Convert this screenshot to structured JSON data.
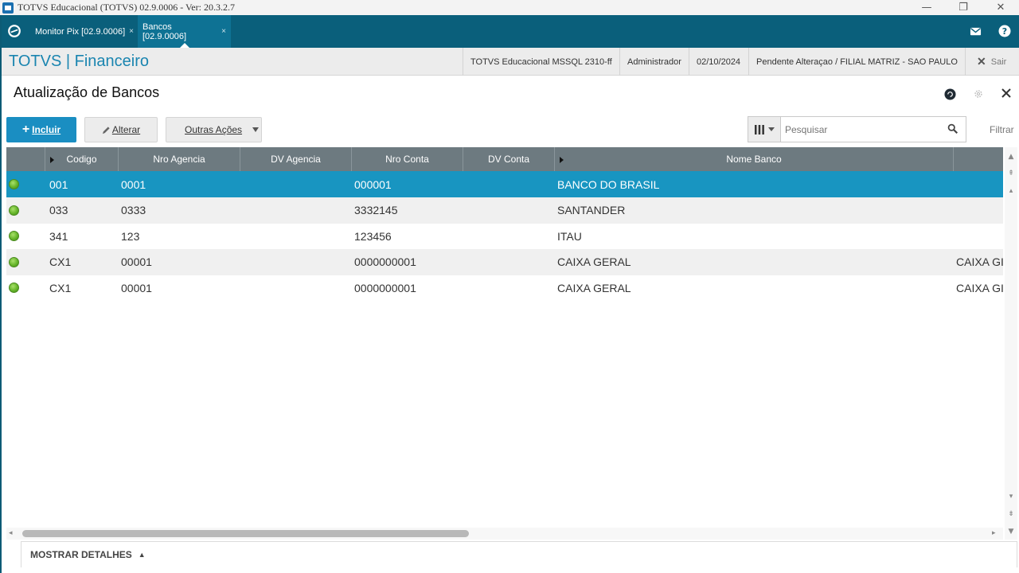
{
  "window": {
    "title": "TOTVS Educacional (TOTVS) 02.9.0006 - Ver: 20.3.2.7",
    "minimize": "—",
    "restore": "❐",
    "close": "✕"
  },
  "tabs": [
    {
      "label": "Monitor Pix [02.9.0006]",
      "close": "×",
      "active": false
    },
    {
      "label": "Bancos [02.9.0006]",
      "close": "×",
      "active": true
    }
  ],
  "header": {
    "brand": "TOTVS | Financeiro",
    "environment": "TOTVS Educacional MSSQL 2310-ff",
    "user": "Administrador",
    "date": "02/10/2024",
    "branch": "Pendente Alteraçao / FILIAL MATRIZ - SAO PAULO",
    "logout_label": "Sair"
  },
  "page": {
    "title": "Atualização de Bancos"
  },
  "toolbar": {
    "include_label": "Incluir",
    "alter_label": "Alterar",
    "other_actions_label": "Outras Ações",
    "search_placeholder": "Pesquisar",
    "filter_label": "Filtrar"
  },
  "grid": {
    "columns": [
      "Codigo",
      "Nro Agencia",
      "DV Agencia",
      "Nro Conta",
      "DV Conta",
      "Nome Banco"
    ],
    "rows": [
      {
        "codigo": "001",
        "agencia": "0001",
        "dv_agencia": "",
        "conta": "000001",
        "dv_conta": "",
        "nome": "BANCO DO BRASIL",
        "extra": "",
        "status": "green"
      },
      {
        "codigo": "033",
        "agencia": "0333",
        "dv_agencia": "",
        "conta": "3332145",
        "dv_conta": "",
        "nome": "SANTANDER",
        "extra": "",
        "status": "green"
      },
      {
        "codigo": "341",
        "agencia": "123",
        "dv_agencia": "",
        "conta": "123456",
        "dv_conta": "",
        "nome": "ITAU",
        "extra": "",
        "status": "green"
      },
      {
        "codigo": "CX1",
        "agencia": "00001",
        "dv_agencia": "",
        "conta": "0000000001",
        "dv_conta": "",
        "nome": "CAIXA GERAL",
        "extra": "CAIXA GI",
        "status": "green"
      },
      {
        "codigo": "CX1",
        "agencia": "00001",
        "dv_agencia": "",
        "conta": "0000000001",
        "dv_conta": "",
        "nome": "CAIXA GERAL",
        "extra": "CAIXA GI",
        "status": "green"
      }
    ],
    "selected_row": 0
  },
  "footer": {
    "details_label": "MOSTRAR DETALHES"
  },
  "colors": {
    "tabbar": "#0a5f7b",
    "brand": "#1a85b0",
    "primary_button": "#1a8ec2",
    "selected_row": "#1895c1",
    "grid_header": "#6d7a80"
  }
}
